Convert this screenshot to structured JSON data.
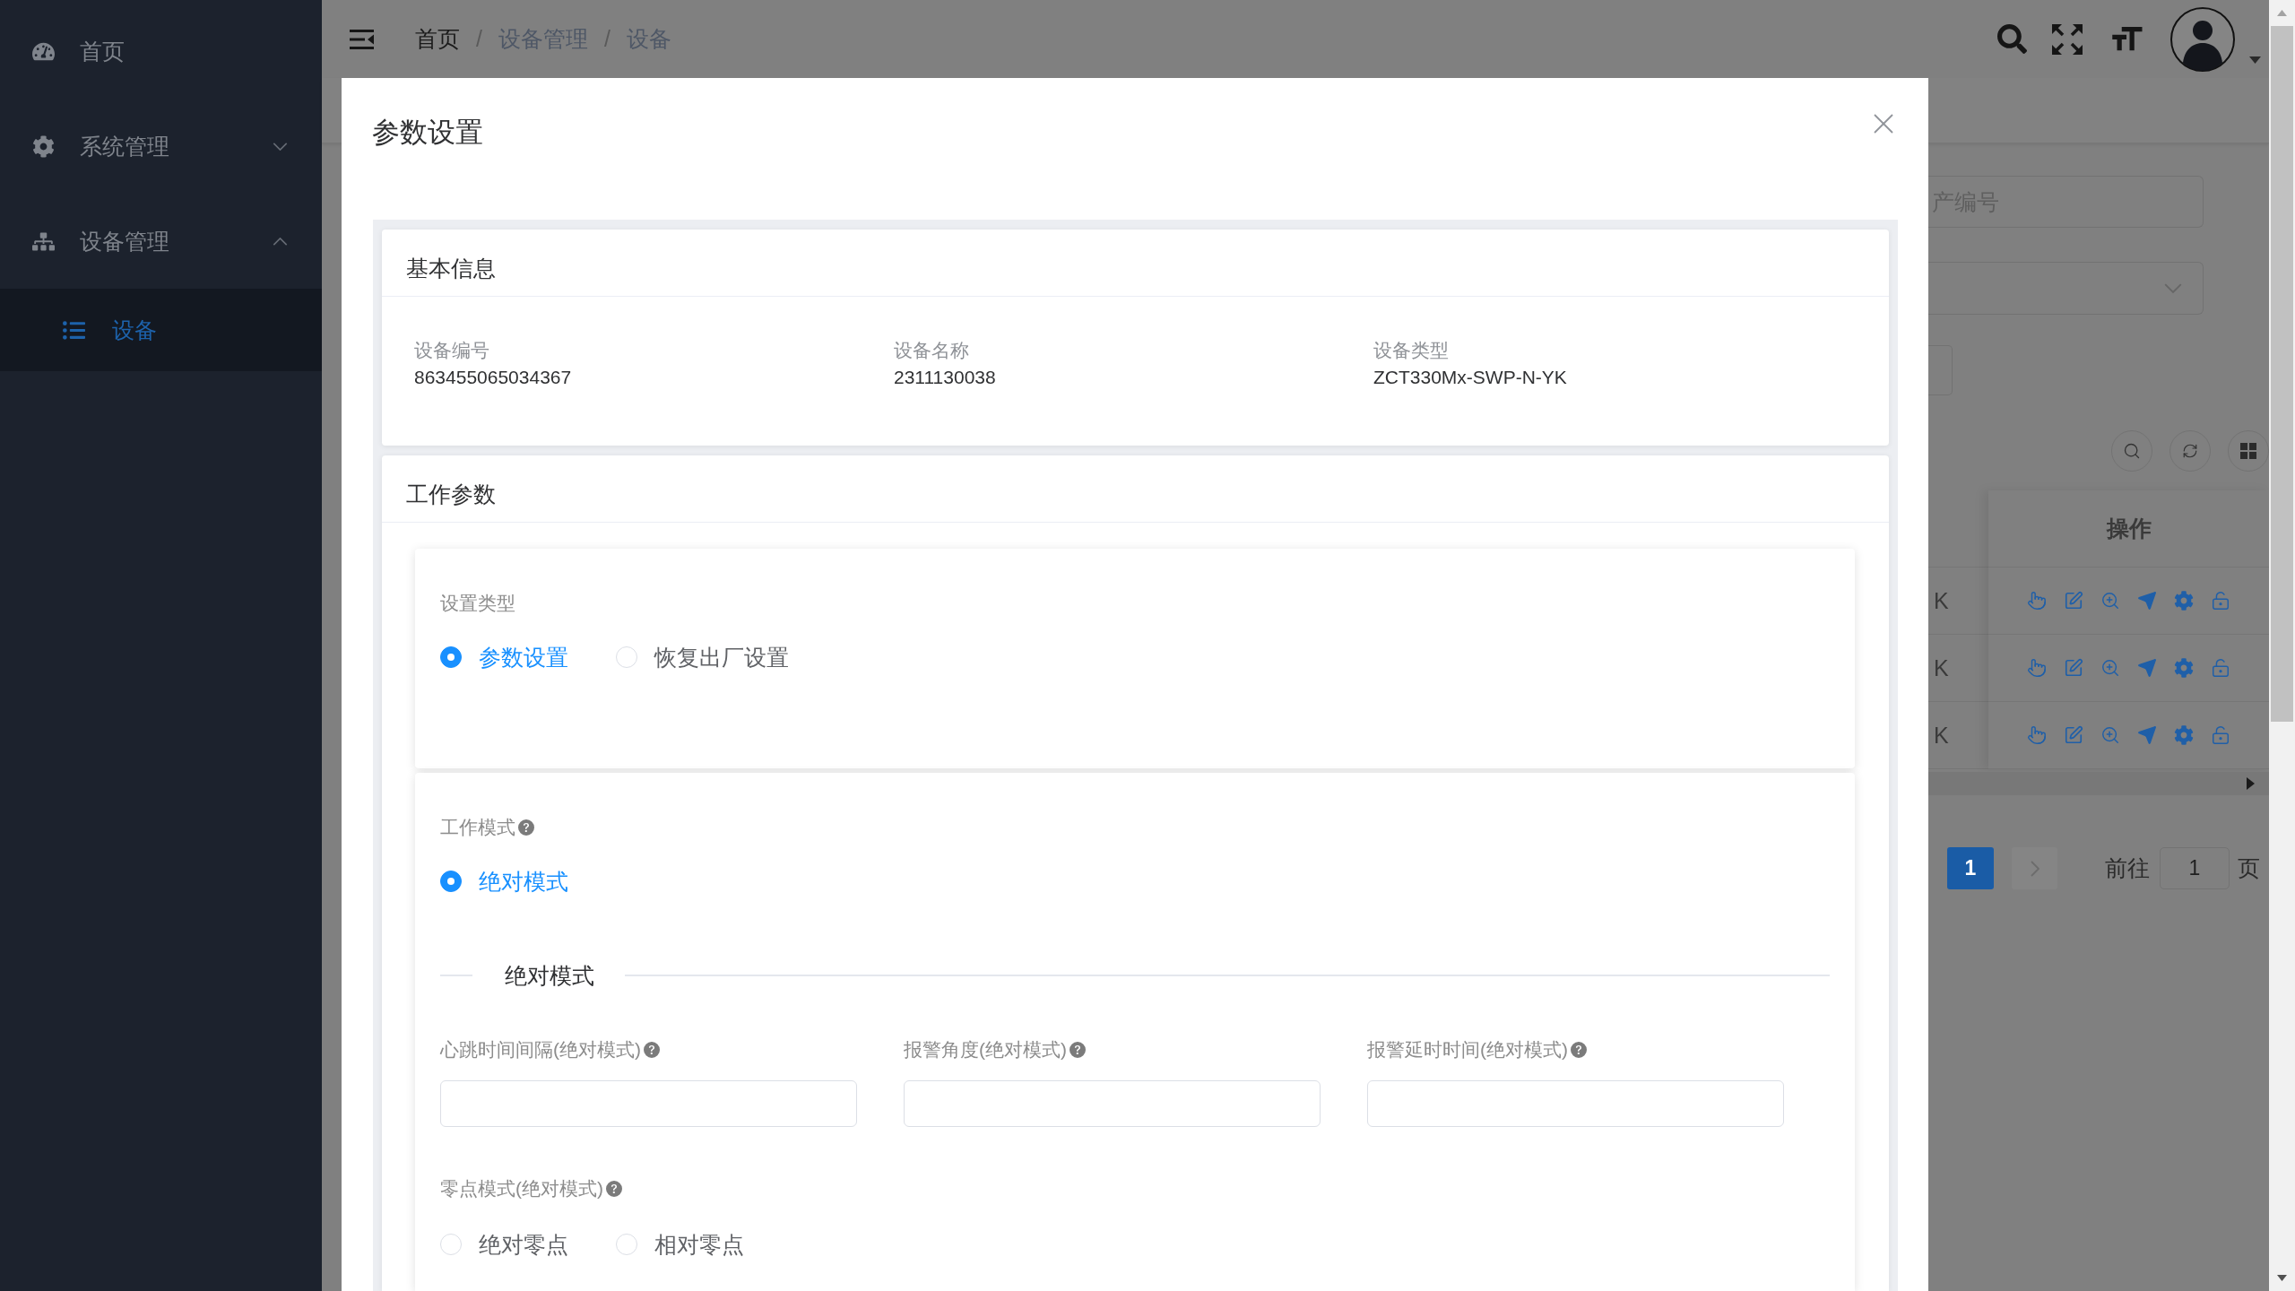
{
  "sidebar": {
    "items": [
      {
        "kind": "link",
        "label": "首页",
        "selected": false
      },
      {
        "kind": "submenu",
        "label": "系统管理",
        "selected": false,
        "expanded": false
      },
      {
        "kind": "submenu",
        "label": "设备管理",
        "selected": false,
        "expanded": true,
        "children": [
          {
            "label": "设备",
            "selected": true
          }
        ]
      }
    ]
  },
  "navbar": {
    "breadcrumb": [
      {
        "label": "首页",
        "link": true
      },
      {
        "separator": "/",
        "label": "设备管理",
        "link": false
      },
      {
        "separator": "/",
        "label": "设备",
        "link": false
      }
    ]
  },
  "dialog": {
    "title": "参数设置",
    "basic_info": {
      "title": "基本信息",
      "fields": [
        {
          "label": "设备编号",
          "value": "863455065034367"
        },
        {
          "label": "设备名称",
          "value": "2311130038"
        },
        {
          "label": "设备类型",
          "value": "ZCT330Mx-SWP-N-YK"
        }
      ]
    },
    "work_params": {
      "title": "工作参数",
      "setting_type": {
        "label": "设置类型",
        "options": [
          {
            "label": "参数设置",
            "selected": true
          },
          {
            "label": "恢复出厂设置",
            "selected": false
          }
        ]
      },
      "work_mode": {
        "label": "工作模式",
        "help": true,
        "options": [
          {
            "label": "绝对模式",
            "selected": true
          }
        ]
      },
      "section_title": "绝对模式",
      "inputs": [
        {
          "label": "心跳时间间隔(绝对模式)",
          "help": true
        },
        {
          "label": "报警角度(绝对模式)",
          "help": true
        },
        {
          "label": "报警延时时间(绝对模式)",
          "help": true
        }
      ],
      "zero_mode": {
        "label": "零点模式(绝对模式)",
        "help": true,
        "options": [
          {
            "label": "绝对零点",
            "selected": false
          },
          {
            "label": "相对零点",
            "selected": false
          }
        ]
      }
    }
  },
  "background": {
    "search_input": {
      "placeholder": "产编号"
    },
    "table": {
      "action_header": "操作",
      "rows": [
        {
          "column_1": "K"
        },
        {
          "column_1": "K"
        },
        {
          "column_1": "K"
        }
      ]
    },
    "pagination": {
      "pages": [
        {
          "label": "1",
          "selected": true
        }
      ],
      "next": {
        "disabled": true
      },
      "goto": {
        "label": "前往",
        "value": "1",
        "suffix": "页"
      }
    }
  }
}
